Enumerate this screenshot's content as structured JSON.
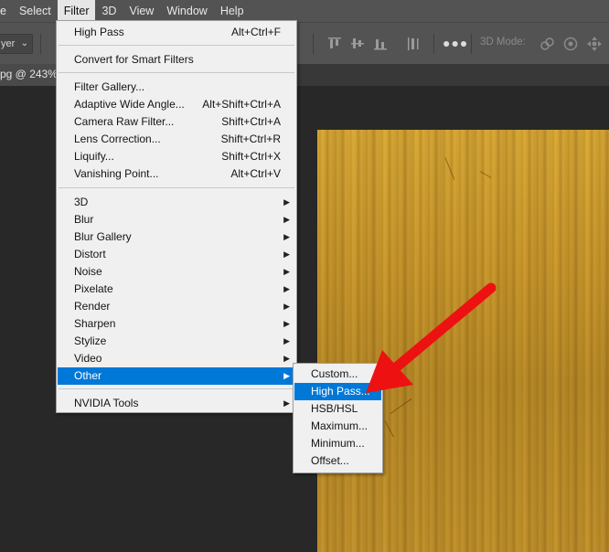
{
  "menubar": {
    "items": [
      "e",
      "Select",
      "Filter",
      "3D",
      "View",
      "Window",
      "Help"
    ],
    "active": "Filter"
  },
  "options_bar": {
    "layer_select_value": "yer",
    "mode3d_label": "3D Mode:"
  },
  "document_tab": {
    "label": "pg @ 243%"
  },
  "filter_menu": {
    "last_filter": {
      "label": "High Pass",
      "shortcut": "Alt+Ctrl+F"
    },
    "convert": {
      "label": "Convert for Smart Filters"
    },
    "group1": [
      {
        "label": "Filter Gallery...",
        "shortcut": ""
      },
      {
        "label": "Adaptive Wide Angle...",
        "shortcut": "Alt+Shift+Ctrl+A"
      },
      {
        "label": "Camera Raw Filter...",
        "shortcut": "Shift+Ctrl+A"
      },
      {
        "label": "Lens Correction...",
        "shortcut": "Shift+Ctrl+R"
      },
      {
        "label": "Liquify...",
        "shortcut": "Shift+Ctrl+X"
      },
      {
        "label": "Vanishing Point...",
        "shortcut": "Alt+Ctrl+V"
      }
    ],
    "submenus": [
      "3D",
      "Blur",
      "Blur Gallery",
      "Distort",
      "Noise",
      "Pixelate",
      "Render",
      "Sharpen",
      "Stylize",
      "Video",
      "Other"
    ],
    "highlighted": "Other",
    "plugins": [
      {
        "label": "NVIDIA Tools"
      }
    ]
  },
  "other_submenu": {
    "items": [
      "Custom...",
      "High Pass...",
      "HSB/HSL",
      "Maximum...",
      "Minimum...",
      "Offset..."
    ],
    "highlighted": "High Pass..."
  },
  "colors": {
    "accent": "#0078d7",
    "annotation_arrow": "#ee1111",
    "canvas_wood": "#c9962a"
  }
}
